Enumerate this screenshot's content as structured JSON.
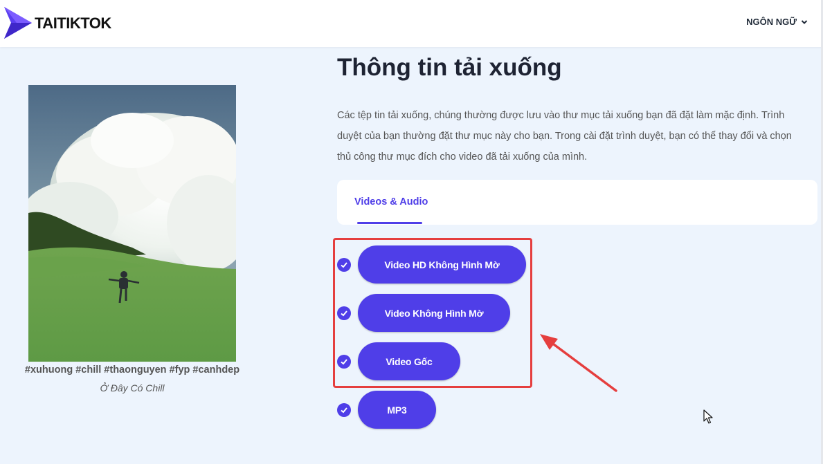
{
  "header": {
    "logo_text": "TAITIKTOK",
    "language_label": "NGÔN NGỮ",
    "brand_color": "#4f3ee8"
  },
  "video": {
    "thumbnail_icon": "video-thumbnail-image",
    "hashtags": "#xuhuong #chill #thaonguyen #fyp #canhdep",
    "title": "Ở Đây Có Chill"
  },
  "main": {
    "title": "Thông tin tải xuống",
    "description": "Các tệp tin tải xuống, chúng thường được lưu vào thư mục tải xuống bạn đã đặt làm mặc định. Trình duyệt của bạn thường đặt thư mục này cho bạn. Trong cài đặt trình duyệt, bạn có thể thay đổi và chọn thủ công thư mục đích cho video đã tải xuống của mình.",
    "tabs": [
      {
        "label": "Videos & Audio",
        "active": true
      }
    ],
    "downloads": [
      {
        "label": "Video HD Không Hình Mờ",
        "checked": true
      },
      {
        "label": "Video Không Hình Mờ",
        "checked": true
      },
      {
        "label": "Video Gốc",
        "checked": true
      },
      {
        "label": "MP3",
        "checked": true
      }
    ]
  },
  "annotation": {
    "highlight_color": "#e53e3e"
  }
}
